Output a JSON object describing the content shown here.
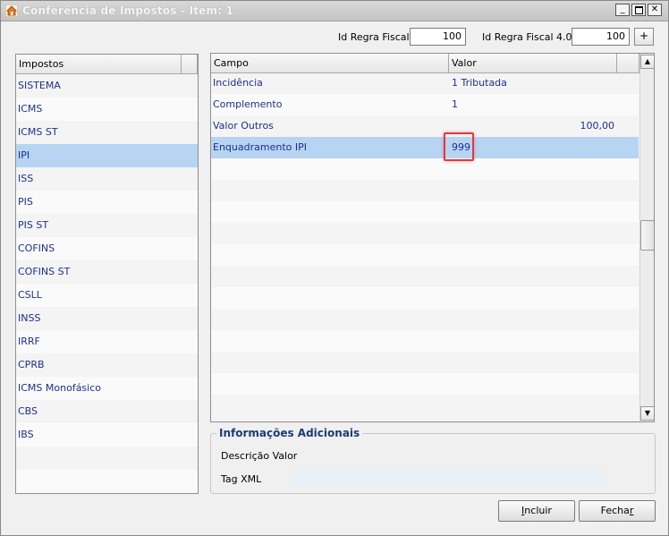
{
  "window": {
    "title": "Conferência de Impostos - Item: 1"
  },
  "top": {
    "id_regra_label": "Id Regra Fiscal",
    "id_regra_value": "100",
    "id_regra40_label": "Id Regra Fiscal 4.0",
    "id_regra40_value": "100",
    "plus_label": "+"
  },
  "impostos": {
    "header": "Impostos",
    "items": [
      {
        "label": "SISTEMA"
      },
      {
        "label": "ICMS"
      },
      {
        "label": "ICMS ST"
      },
      {
        "label": "IPI"
      },
      {
        "label": "ISS"
      },
      {
        "label": "PIS"
      },
      {
        "label": "PIS ST"
      },
      {
        "label": "COFINS"
      },
      {
        "label": "COFINS ST"
      },
      {
        "label": "CSLL"
      },
      {
        "label": "INSS"
      },
      {
        "label": "IRRF"
      },
      {
        "label": "CPRB"
      },
      {
        "label": "ICMS Monofásico"
      },
      {
        "label": "CBS"
      },
      {
        "label": "IBS"
      }
    ],
    "selected": "IPI"
  },
  "campos": {
    "header_campo": "Campo",
    "header_valor": "Valor",
    "rows": [
      {
        "campo": "Incidência",
        "valor": "1 Tributada",
        "valor_right": ""
      },
      {
        "campo": "Complemento",
        "valor": "1",
        "valor_right": ""
      },
      {
        "campo": "Valor Outros",
        "valor": "",
        "valor_right": "100,00"
      },
      {
        "campo": "Enquadramento IPI",
        "valor": "999",
        "valor_right": ""
      }
    ]
  },
  "info": {
    "title": "Informações Adicionais",
    "descricao_label": "Descrição Valor",
    "tag_label": "Tag XML"
  },
  "footer": {
    "incluir_first": "I",
    "incluir_rest": "ncluir",
    "fechar_first": "Fecha",
    "fechar_ul": "r"
  },
  "colors": {
    "selected_row": "#b7d4f3",
    "text_blue": "#1f2f8a",
    "highlight_red": "#e23a3a"
  }
}
